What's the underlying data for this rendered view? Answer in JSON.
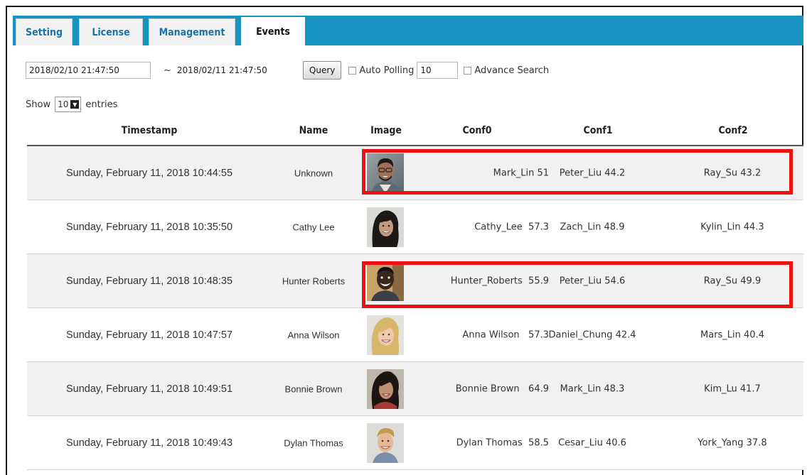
{
  "tabs": [
    {
      "label": "Setting"
    },
    {
      "label": "License"
    },
    {
      "label": "Management"
    },
    {
      "label": "Events"
    }
  ],
  "filters": {
    "start_date": "2018/02/10",
    "start_time": "21:47:50",
    "separator": "~",
    "end_date": "2018/02/11",
    "end_time": "21:47:50",
    "query_label": "Query",
    "auto_polling_label": "Auto Polling",
    "auto_polling_value": "10",
    "advance_search_label": "Advance Search"
  },
  "length": {
    "show_label": "Show",
    "value": "10",
    "entries_label": "entries"
  },
  "table": {
    "columns": [
      "Timestamp",
      "Name",
      "Image",
      "Conf0",
      "Conf1",
      "Conf2"
    ],
    "rows": [
      {
        "timestamp": "Sunday, February 11, 2018 10:44:55",
        "name": "Unknown",
        "face": "man-with-glasses",
        "conf0": "Mark_Lin 51",
        "conf1": "Peter_Liu 44.2",
        "conf2": "Ray_Su 43.2",
        "highlighted": true
      },
      {
        "timestamp": "Sunday, February 11, 2018 10:35:50",
        "name": "Cathy Lee",
        "face": "woman-dark-hair",
        "conf0": "Cathy_Lee  57.3",
        "conf1": "Zach_Lin 48.9",
        "conf2": "Kylin_Lin 44.3",
        "highlighted": false
      },
      {
        "timestamp": "Sunday, February 11, 2018 10:48:35",
        "name": "Hunter Roberts",
        "face": "man-smiling",
        "conf0": "Hunter_Roberts  55.9",
        "conf1": "Peter_Liu 54.6",
        "conf2": "Ray_Su 49.9",
        "highlighted": true
      },
      {
        "timestamp": "Sunday, February 11, 2018 10:47:57",
        "name": "Anna Wilson",
        "face": "woman-blonde",
        "conf0": "Anna Wilson   57.3",
        "conf1": "Daniel_Chung 42.4",
        "conf2": "Mars_Lin 40.4",
        "highlighted": false
      },
      {
        "timestamp": "Sunday, February 11, 2018 10:49:51",
        "name": "Bonnie Brown",
        "face": "woman-dark-hair",
        "conf0": "Bonnie Brown   64.9",
        "conf1": "Mark_Lin 48.3",
        "conf2": "Kim_Lu 41.7",
        "highlighted": false
      },
      {
        "timestamp": "Sunday, February 11, 2018 10:49:43",
        "name": "Dylan Thomas",
        "face": "man-blond",
        "conf0": "Dylan Thomas  58.5",
        "conf1": "Cesar_Liu 40.6",
        "conf2": "York_Yang 37.8",
        "highlighted": false
      }
    ]
  },
  "colors": {
    "tab_bar": "#1793c4",
    "tab_text": "#1a73a8",
    "highlight": "#ee1111"
  }
}
